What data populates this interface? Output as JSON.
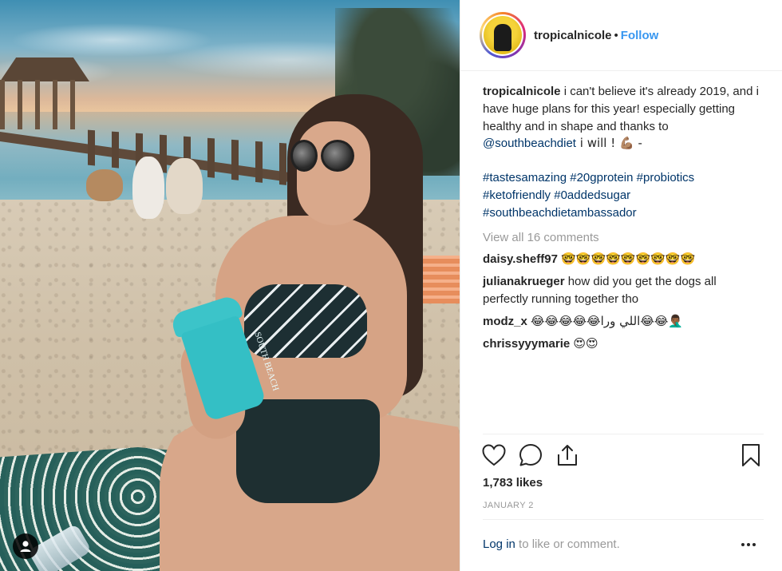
{
  "header": {
    "username": "tropicalnicole",
    "separator": "•",
    "follow_label": "Follow"
  },
  "caption": {
    "username": "tropicalnicole",
    "text_1": " i can't believe it's already 2019, and i have huge plans for this year! especially getting healthy and in shape and thanks to ",
    "mention": "@southbeachdiet",
    "text_2": " i will ! 💪🏽 -",
    "hashtags": [
      "#tastesamazing",
      "#20gprotein",
      "#probiotics",
      "#ketofriendly",
      "#0addedsugar",
      "#southbeachdietambassador"
    ]
  },
  "view_all_comments": "View all 16 comments",
  "comments": [
    {
      "username": "daisy.sheff97",
      "text": "🤓🤓🤓🤓🤓🤓🤓🤓🤓"
    },
    {
      "username": "julianakrueger",
      "text": "how did you get the dogs all perfectly running together tho"
    },
    {
      "username": "modz_x",
      "text": "😂😂😂😂😂اللي ورا😂😂🤦🏾‍♂️"
    },
    {
      "username": "chrissyyymarie",
      "text": "😍😍"
    }
  ],
  "likes": "1,783 likes",
  "date": "JANUARY 2",
  "login": {
    "link": "Log in",
    "rest": " to like or comment."
  },
  "photo": {
    "shaker_text": "SOUTH BEACH"
  },
  "icons": {
    "like": "heart-icon",
    "comment": "comment-icon",
    "share": "share-icon",
    "save": "bookmark-icon",
    "more": "more-options-icon",
    "user_tag": "user-tag-icon"
  },
  "colors": {
    "follow": "#3897f0",
    "link": "#003569",
    "muted": "#999999"
  }
}
